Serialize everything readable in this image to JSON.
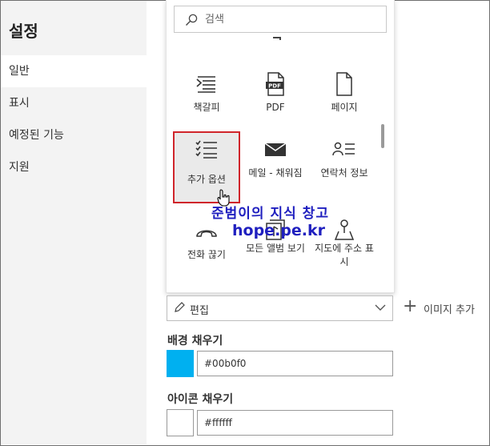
{
  "sidebar": {
    "title": "설정",
    "items": [
      {
        "label": "일반",
        "active": true
      },
      {
        "label": "표시",
        "active": false
      },
      {
        "label": "예정된 기능",
        "active": false
      },
      {
        "label": "지원",
        "active": false
      }
    ]
  },
  "icon_picker": {
    "search_placeholder": "검색",
    "tiles": [
      {
        "label": "책갈피",
        "icon": "bookmark-lines-icon"
      },
      {
        "label": "PDF",
        "icon": "pdf-file-icon"
      },
      {
        "label": "페이지",
        "icon": "page-icon"
      },
      {
        "label": "추가 옵션",
        "icon": "checklist-icon",
        "selected": true
      },
      {
        "label": "메일 - 채워짐",
        "icon": "mail-filled-icon"
      },
      {
        "label": "연락처 정보",
        "icon": "contact-info-icon"
      },
      {
        "label": "전화 끊기",
        "icon": "hang-up-icon"
      },
      {
        "label": "모든 앨범 보기",
        "icon": "all-albums-icon"
      },
      {
        "label": "지도에 주소 표시",
        "icon": "map-pin-icon"
      }
    ]
  },
  "watermark": {
    "line1": "준범이의 지식 창고",
    "line2": "hope.pe.kr"
  },
  "edit_dropdown": {
    "label": "편집"
  },
  "add_image": {
    "label": "이미지 추가"
  },
  "background_fill": {
    "label": "배경 채우기",
    "value": "#00b0f0",
    "color": "#00b0f0"
  },
  "icon_fill": {
    "label": "아이콘 채우기",
    "value": "#ffffff",
    "color": "#ffffff"
  }
}
